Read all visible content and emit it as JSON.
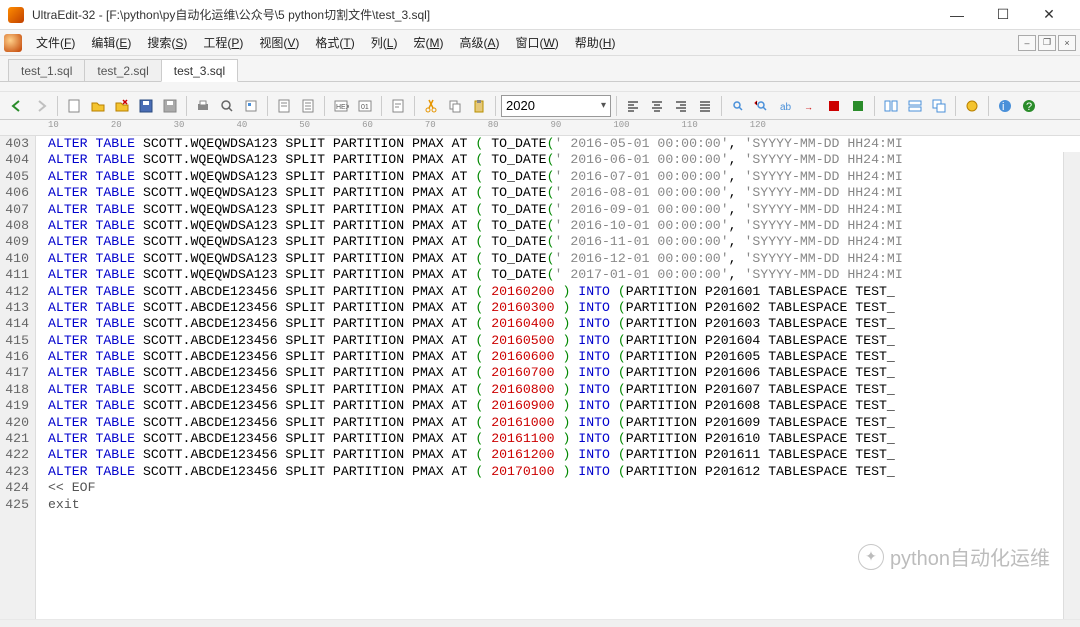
{
  "title": "UltraEdit-32 - [F:\\python\\py自动化运维\\公众号\\5 python切割文件\\test_3.sql]",
  "menu": [
    "文件(F)",
    "编辑(E)",
    "搜索(S)",
    "工程(P)",
    "视图(V)",
    "格式(T)",
    "列(L)",
    "宏(M)",
    "高级(A)",
    "窗口(W)",
    "帮助(H)"
  ],
  "tabs": [
    {
      "label": "test_1.sql",
      "active": false
    },
    {
      "label": "test_2.sql",
      "active": false
    },
    {
      "label": "test_3.sql",
      "active": true
    }
  ],
  "find_value": "2020",
  "ruler_marks": [
    "10",
    "20",
    "30",
    "40",
    "50",
    "60",
    "70",
    "80",
    "90",
    "100",
    "110",
    "120"
  ],
  "line_start": 403,
  "todate_lines": [
    {
      "date": "2016-05-01"
    },
    {
      "date": "2016-06-01"
    },
    {
      "date": "2016-07-01"
    },
    {
      "date": "2016-08-01"
    },
    {
      "date": "2016-09-01"
    },
    {
      "date": "2016-10-01"
    },
    {
      "date": "2016-11-01"
    },
    {
      "date": "2016-12-01"
    },
    {
      "date": "2017-01-01"
    }
  ],
  "int_lines": [
    {
      "num": "20160200",
      "part": "P201601"
    },
    {
      "num": "20160300",
      "part": "P201602"
    },
    {
      "num": "20160400",
      "part": "P201603"
    },
    {
      "num": "20160500",
      "part": "P201604"
    },
    {
      "num": "20160600",
      "part": "P201605"
    },
    {
      "num": "20160700",
      "part": "P201606"
    },
    {
      "num": "20160800",
      "part": "P201607"
    },
    {
      "num": "20160900",
      "part": "P201608"
    },
    {
      "num": "20161000",
      "part": "P201609"
    },
    {
      "num": "20161100",
      "part": "P201610"
    },
    {
      "num": "20161200",
      "part": "P201611"
    },
    {
      "num": "20170100",
      "part": "P201612"
    }
  ],
  "tail_lines": [
    "<< EOF",
    "exit"
  ],
  "table1": "SCOTT.WQEQWDSA123",
  "table2": "SCOTT.ABCDE123456",
  "common_prefix": "ALTER TABLE",
  "split_clause": "SPLIT PARTITION PMAX AT",
  "todate_fn": "TO_DATE",
  "time_suffix": " 00:00:00",
  "fmt_str": "'SYYYY-MM-DD HH24:MI",
  "into_kw": "INTO",
  "partition_kw": "PARTITION",
  "tablespace_tail": "TABLESPACE TEST_",
  "watermark": "python自动化运维"
}
